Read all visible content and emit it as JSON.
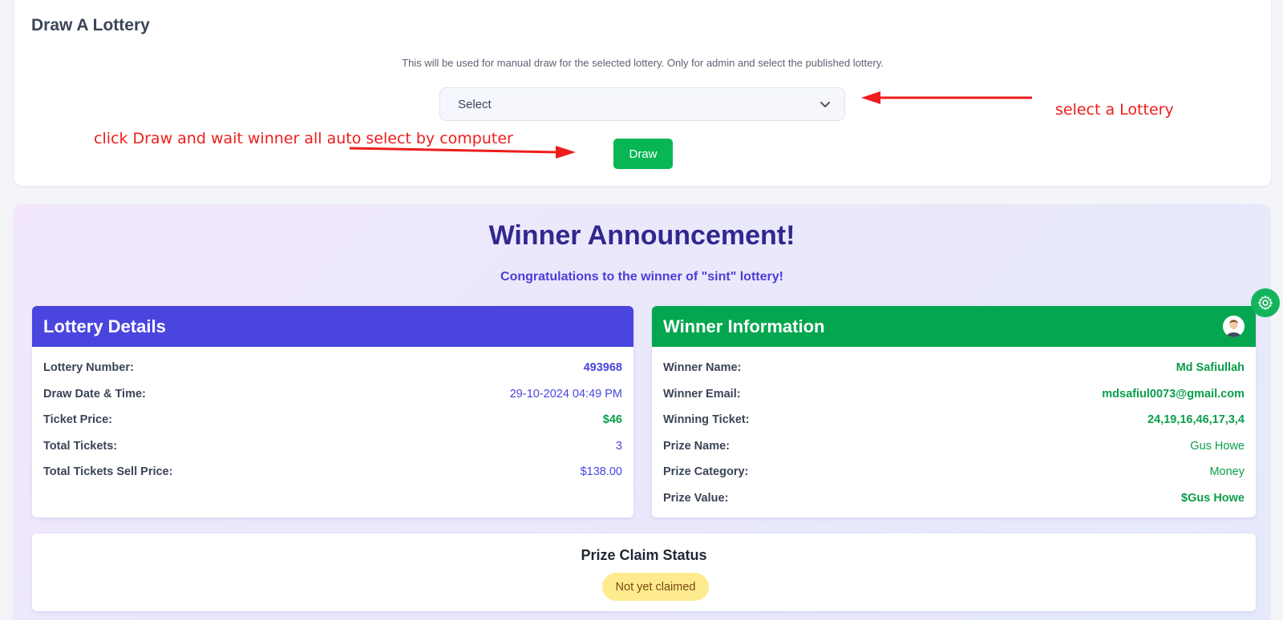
{
  "draw": {
    "title": "Draw A Lottery",
    "description": "This will be used for manual draw for the selected lottery. Only for admin and select the published lottery.",
    "select_value": "Select",
    "button_label": "Draw"
  },
  "annotations": {
    "select_note": "select a Lottery",
    "draw_note": "click Draw and wait winner all auto select by computer"
  },
  "winner": {
    "title": "Winner Announcement!",
    "subtitle": "Congratulations to the winner of \"sint\" lottery!"
  },
  "lottery_details": {
    "header": "Lottery Details",
    "rows": [
      {
        "label": "Lottery Number:",
        "value": "493968"
      },
      {
        "label": "Draw Date & Time:",
        "value": "29-10-2024 04:49 PM"
      },
      {
        "label": "Ticket Price:",
        "value": "$46"
      },
      {
        "label": "Total Tickets:",
        "value": "3"
      },
      {
        "label": "Total Tickets Sell Price:",
        "value": "$138.00"
      }
    ]
  },
  "winner_info": {
    "header": "Winner Information",
    "rows": [
      {
        "label": "Winner Name:",
        "value": "Md Safiullah"
      },
      {
        "label": "Winner Email:",
        "value": "mdsafiul0073@gmail.com"
      },
      {
        "label": "Winning Ticket:",
        "value": "24,19,16,46,17,3,4"
      },
      {
        "label": "Prize Name:",
        "value": "Gus Howe"
      },
      {
        "label": "Prize Category:",
        "value": "Money"
      },
      {
        "label": "Prize Value:",
        "value": "$Gus Howe"
      }
    ]
  },
  "claim": {
    "title": "Prize Claim Status",
    "status": "Not yet claimed"
  },
  "icons": {
    "settings": "gear-icon",
    "dropdown": "chevron-down-icon",
    "avatar": "user-avatar"
  },
  "colors": {
    "primary": "#4a45de",
    "success": "#04a64f",
    "annotation": "#ee1c1c",
    "badge": "#fdeb8e"
  }
}
